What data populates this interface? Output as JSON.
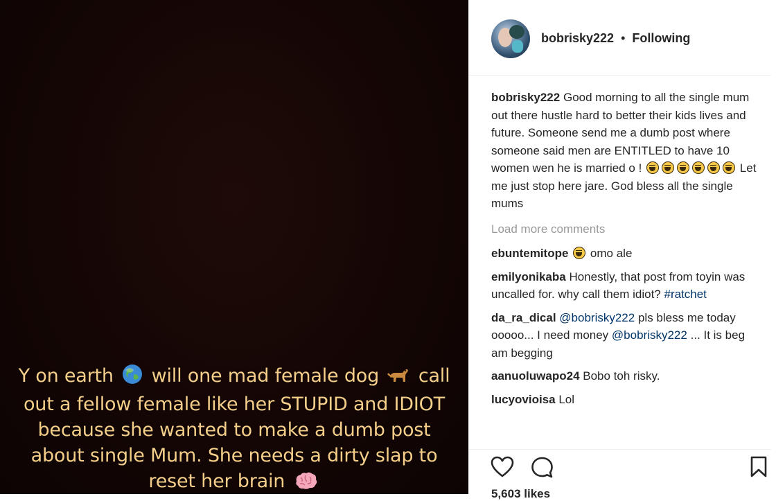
{
  "media": {
    "caption_lines": [
      {
        "before": "Y on earth",
        "after": "will one mad female dog",
        "end": "call"
      },
      "out a fellow female like her STUPID and IDIOT",
      "because she wanted to make a dumb post",
      "about single Mum. She needs a dirty slap to",
      {
        "before": "reset her brain"
      }
    ],
    "icons": [
      "globe-emoji",
      "dog-emoji",
      "brain-emoji"
    ]
  },
  "header": {
    "username": "bobrisky222",
    "separator": "•",
    "follow_status": "Following"
  },
  "caption": {
    "username": "bobrisky222",
    "text_1": "Good morning to all the single mum out there hustle hard to better their kids lives and future. Someone send me a dumb post where someone said men are ENTITLED to have 10 women wen he is married o !",
    "text_2": "Let me just stop here jare. God bless all the single mums",
    "emoji_count": 6
  },
  "load_more": "Load more comments",
  "comments": [
    {
      "username": "ebuntemitope",
      "text": "omo ale"
    },
    {
      "username": "emilyonikaba",
      "text": "Honestly, that post from toyin was uncalled for. why call them idiot?",
      "hashtag": "#ratchet"
    },
    {
      "username": "da_ra_dical",
      "mention_1": "@bobrisky222",
      "text_1": "pls bless me today ooooo... I need money",
      "mention_2": "@bobrisky222",
      "text_2": "... It is beg am begging"
    },
    {
      "username": "aanuoluwapo24",
      "text": "Bobo toh risky."
    },
    {
      "username": "lucyovioisa",
      "text": "Lol"
    }
  ],
  "likes": "5,603 likes",
  "icons": {
    "like": "heart-icon",
    "comment": "comment-bubble-icon",
    "save": "bookmark-icon"
  }
}
